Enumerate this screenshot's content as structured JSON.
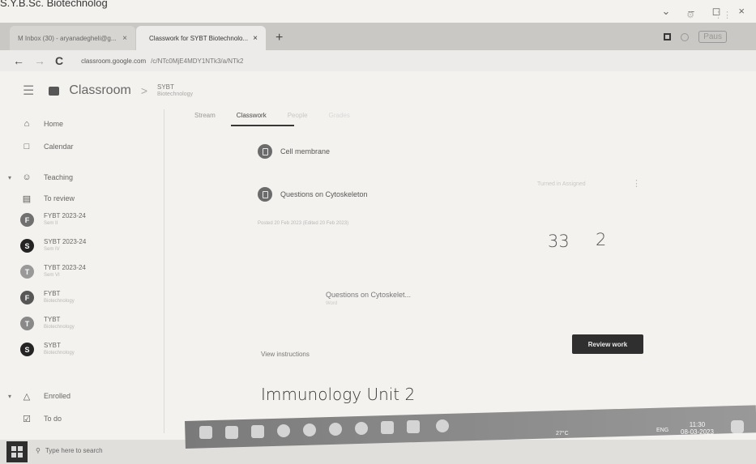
{
  "caption": "S.Y.B.Sc. Biotechnolog",
  "window_controls": [
    "⌄",
    "–",
    "◻",
    "×"
  ],
  "browser": {
    "tabs": [
      {
        "label": "M  Inbox (30) - aryanadegheli@g...",
        "close": "×"
      },
      {
        "label": "Classwork for SYBT Biotechnolo...",
        "close": "×"
      }
    ],
    "new_tab": "+",
    "right_badge": "Paus",
    "back": "←",
    "forward": "→",
    "reload": "C",
    "url_host": "classroom.google.com",
    "url_path": "/c/NTc0MjE4MDY1NTk3/a/NTk2"
  },
  "appbar": {
    "brand": "Classroom",
    "separator": ">",
    "class_name": "SYBT",
    "class_subtitle": "Biotechnology"
  },
  "sidebar": {
    "home": "Home",
    "calendar": "Calendar",
    "teaching": "Teaching",
    "to_review": "To review",
    "classes": [
      {
        "initial": "F",
        "title": "FYBT 2023-24",
        "sub": "Sem II",
        "color": "#6f6f6f"
      },
      {
        "initial": "S",
        "title": "SYBT 2023-24",
        "sub": "Sem IV",
        "color": "#1f1f1f"
      },
      {
        "initial": "T",
        "title": "TYBT 2023-24",
        "sub": "Sem VI",
        "color": "#9a9a9a"
      },
      {
        "initial": "F",
        "title": "FYBT",
        "sub": "Biotechnology",
        "color": "#555555"
      },
      {
        "initial": "T",
        "title": "TYBT",
        "sub": "Biotechnology",
        "color": "#8a8a8a"
      },
      {
        "initial": "S",
        "title": "SYBT",
        "sub": "Biotechnology",
        "color": "#1f1f1f"
      }
    ],
    "enrolled": "Enrolled",
    "todo": "To do"
  },
  "class_tabs": [
    "Stream",
    "Classwork",
    "People",
    "Grades"
  ],
  "materials": [
    {
      "title": "Cell membrane"
    },
    {
      "title": "Questions on Cytoskeleton"
    }
  ],
  "posted": "Posted 20 Feb 2023 (Edited 20 Feb 2023)",
  "stats": {
    "turned_in": "33",
    "assigned": "2",
    "caption": "Turned in   Assigned"
  },
  "attachment": {
    "title": "Questions on Cytoskelet...",
    "sub": "Word"
  },
  "view_instructions": "View instructions",
  "review_button": "Review work",
  "handwritten_note": "Immunology Unit 2",
  "taskbar": {
    "search_placeholder": "Type here to search",
    "weather": "27°C",
    "lang": "ENG",
    "time": "11:30",
    "date": "08-03-2023"
  }
}
